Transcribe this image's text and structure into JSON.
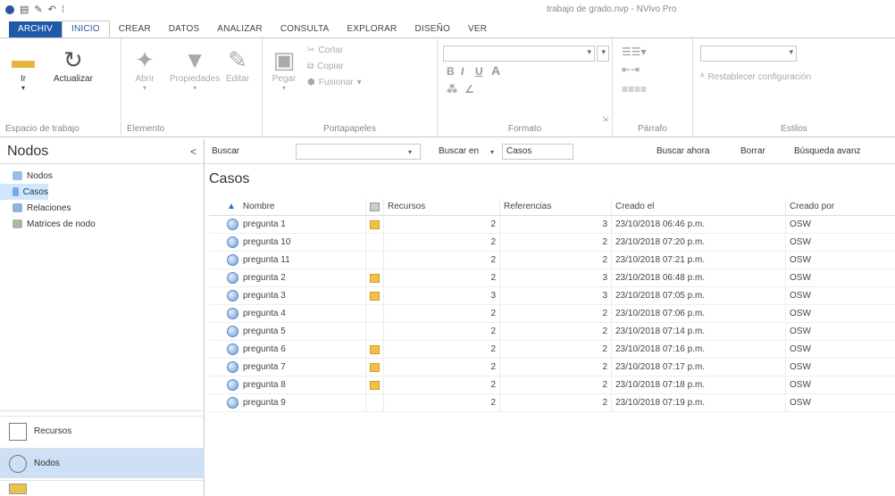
{
  "window": {
    "title": "trabajo de grado.nvp - NVivo Pro",
    "qat": [
      "●",
      "▤",
      "✎",
      "↶",
      "·",
      "⁞"
    ]
  },
  "tabs": [
    {
      "label": "ARCHIV"
    },
    {
      "label": "INICIO"
    },
    {
      "label": "CREAR"
    },
    {
      "label": "DATOS"
    },
    {
      "label": "ANALIZAR"
    },
    {
      "label": "CONSULTA"
    },
    {
      "label": "EXPLORAR"
    },
    {
      "label": "DISEÑO"
    },
    {
      "label": "VER"
    }
  ],
  "ribbon": {
    "workspace": {
      "label": "Espacio de trabajo",
      "go": "Ir",
      "refresh": "Actualizar"
    },
    "element": {
      "label": "Elemento",
      "open": "Abrir",
      "properties": "Propiedades",
      "edit": "Editar"
    },
    "clipboard": {
      "label": "Portapapeles",
      "paste": "Pegar",
      "cut": "Cortar",
      "copy": "Copiar",
      "merge": "Fusionar"
    },
    "format": {
      "label": "Formato",
      "bold": "B",
      "italic": "I",
      "underline": "U",
      "fontcolor": "A"
    },
    "paragraph": {
      "label": "Párrafo"
    },
    "styles": {
      "label": "Estilos",
      "reset": "Restablecer configuración"
    }
  },
  "leftpanel": {
    "title": "Nodos",
    "collapse": "<",
    "tree": [
      {
        "label": "Nodos"
      },
      {
        "label": "Casos"
      },
      {
        "label": "Relaciones"
      },
      {
        "label": "Matrices de nodo"
      }
    ],
    "nav": [
      {
        "label": "Recursos"
      },
      {
        "label": "Nodos"
      }
    ]
  },
  "searchbar": {
    "find_label": "Buscar",
    "find_value": "",
    "look_in_label": "Buscar en",
    "look_in_value": "Casos",
    "find_now": "Buscar ahora",
    "clear": "Borrar",
    "advanced": "Búsqueda avanz"
  },
  "list": {
    "title": "Casos",
    "columns": [
      "Nombre",
      "Recursos",
      "Referencias",
      "Creado el",
      "Creado por"
    ],
    "rows": [
      {
        "name": "pregunta 1",
        "res": true,
        "recursos": "2",
        "referencias": "3",
        "created": "23/10/2018 06:46 p.m.",
        "by": "OSW"
      },
      {
        "name": "pregunta 10",
        "res": false,
        "recursos": "2",
        "referencias": "2",
        "created": "23/10/2018 07:20 p.m.",
        "by": "OSW"
      },
      {
        "name": "pregunta 11",
        "res": false,
        "recursos": "2",
        "referencias": "2",
        "created": "23/10/2018 07:21 p.m.",
        "by": "OSW"
      },
      {
        "name": "pregunta 2",
        "res": true,
        "recursos": "2",
        "referencias": "3",
        "created": "23/10/2018 06:48 p.m.",
        "by": "OSW"
      },
      {
        "name": "pregunta 3",
        "res": true,
        "recursos": "3",
        "referencias": "3",
        "created": "23/10/2018 07:05 p.m.",
        "by": "OSW"
      },
      {
        "name": "pregunta 4",
        "res": false,
        "recursos": "2",
        "referencias": "2",
        "created": "23/10/2018 07:06 p.m.",
        "by": "OSW"
      },
      {
        "name": "pregunta 5",
        "res": false,
        "recursos": "2",
        "referencias": "2",
        "created": "23/10/2018 07:14 p.m.",
        "by": "OSW"
      },
      {
        "name": "pregunta 6",
        "res": true,
        "recursos": "2",
        "referencias": "2",
        "created": "23/10/2018 07:16 p.m.",
        "by": "OSW"
      },
      {
        "name": "pregunta 7",
        "res": true,
        "recursos": "2",
        "referencias": "2",
        "created": "23/10/2018 07:17 p.m.",
        "by": "OSW"
      },
      {
        "name": "pregunta 8",
        "res": true,
        "recursos": "2",
        "referencias": "2",
        "created": "23/10/2018 07:18 p.m.",
        "by": "OSW"
      },
      {
        "name": "pregunta 9",
        "res": false,
        "recursos": "2",
        "referencias": "2",
        "created": "23/10/2018 07:19 p.m.",
        "by": "OSW"
      }
    ]
  },
  "colors": {
    "accent": "#1f5aa8",
    "selection": "#cde8ff",
    "resource": "#f2c14a"
  }
}
